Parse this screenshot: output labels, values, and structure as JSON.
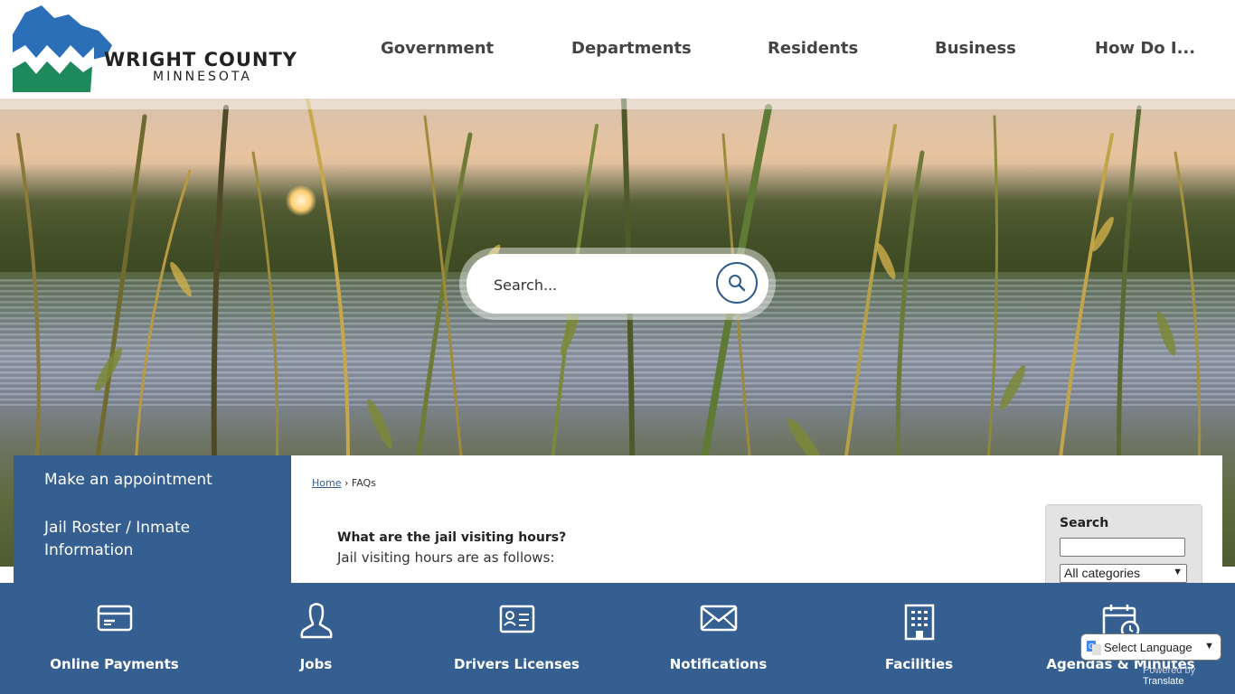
{
  "header": {
    "logo_title": "WRIGHT COUNTY",
    "logo_subtitle": "MINNESOTA",
    "nav": [
      {
        "label": "Government"
      },
      {
        "label": "Departments"
      },
      {
        "label": "Residents"
      },
      {
        "label": "Business"
      },
      {
        "label": "How Do I..."
      }
    ]
  },
  "hero_search": {
    "placeholder": "Search..."
  },
  "side_panel": {
    "links": [
      {
        "label": "Make an appointment"
      },
      {
        "label": "Jail Roster / Inmate Information"
      }
    ]
  },
  "breadcrumb": {
    "home": "Home",
    "separator": "›",
    "current": "FAQs"
  },
  "faq": {
    "question": "What are the jail visiting hours?",
    "answer": "Jail visiting hours are as follows:"
  },
  "faq_search": {
    "title": "Search",
    "category_selected": "All categories"
  },
  "quick_links": [
    {
      "label": "Online Payments",
      "icon": "credit-card-icon"
    },
    {
      "label": "Jobs",
      "icon": "person-icon"
    },
    {
      "label": "Drivers Licenses",
      "icon": "id-card-icon"
    },
    {
      "label": "Notifications",
      "icon": "envelope-icon"
    },
    {
      "label": "Facilities",
      "icon": "building-icon"
    },
    {
      "label": "Agendas & Minutes",
      "icon": "calendar-clock-icon"
    }
  ],
  "translate": {
    "label": "Select Language",
    "powered_prefix": "Powered by",
    "powered_brand": "Translate"
  },
  "colors": {
    "brand_blue": "#365f91",
    "logo_blue": "#2a6fb8",
    "logo_green": "#1e8a5a",
    "nav_text": "#444444"
  }
}
